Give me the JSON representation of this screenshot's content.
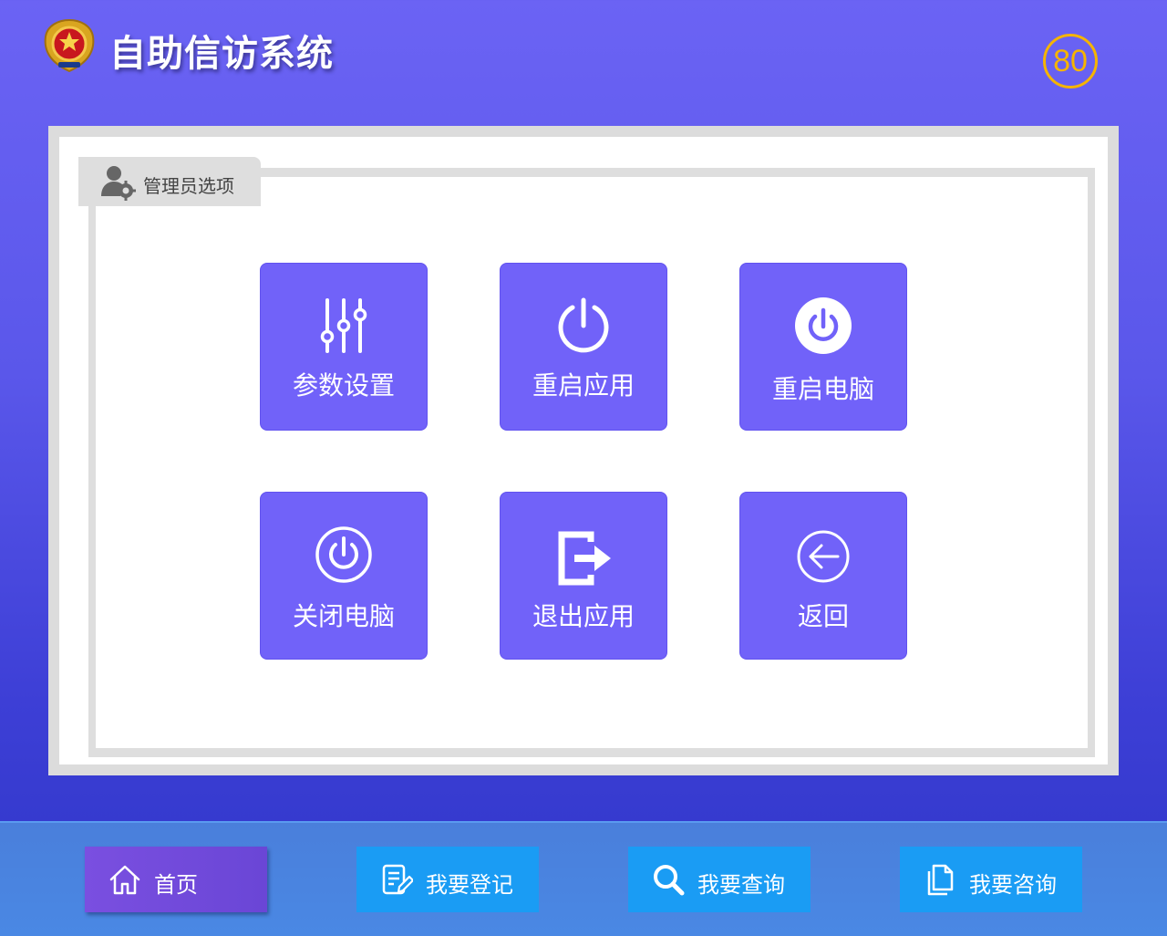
{
  "header": {
    "title": "自助信访系统",
    "countdown": "80",
    "emblem_icon": "police-emblem-icon"
  },
  "panel": {
    "tab_label": "管理员选项",
    "tab_icon": "admin-user-gear-icon"
  },
  "tiles": [
    {
      "label": "参数设置",
      "icon": "sliders-icon"
    },
    {
      "label": "重启应用",
      "icon": "power-icon"
    },
    {
      "label": "重启电脑",
      "icon": "power-circle-filled-icon"
    },
    {
      "label": "关闭电脑",
      "icon": "power-circle-icon"
    },
    {
      "label": "退出应用",
      "icon": "exit-arrow-icon"
    },
    {
      "label": "返回",
      "icon": "back-arrow-circle-icon"
    }
  ],
  "bottom_nav": [
    {
      "label": "首页",
      "icon": "home-icon",
      "active": true
    },
    {
      "label": "我要登记",
      "icon": "edit-document-icon",
      "active": false
    },
    {
      "label": "我要查询",
      "icon": "search-icon",
      "active": false
    },
    {
      "label": "我要咨询",
      "icon": "document-copy-icon",
      "active": false
    }
  ],
  "colors": {
    "tile": "#7162f9",
    "countdown": "#f5b400",
    "nav_button": "#1a9cf4",
    "nav_active": "#7a4fe0"
  }
}
